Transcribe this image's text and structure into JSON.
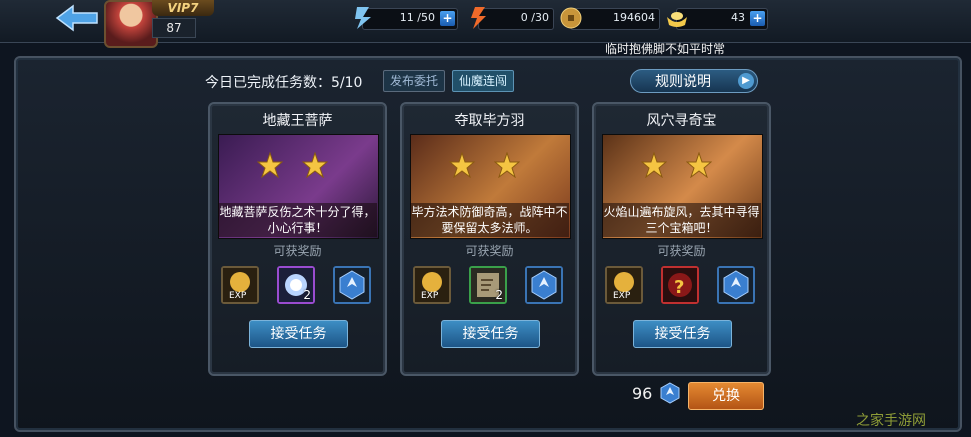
{
  "topbar": {
    "vip_label": "VIP7",
    "level": "87",
    "stamina": "11 /50",
    "energy": "0 /30",
    "gold": "194604",
    "ingots": "43",
    "plus_symbol": "+",
    "notice": "临时抱佛脚不如平时常"
  },
  "header": {
    "tasks_status": "今日已完成任务数：5/10",
    "publish_label": "发布委托",
    "xianmo_label": "仙魔连闯",
    "rules_label": "规则说明"
  },
  "cards": [
    {
      "title": "地藏王菩萨",
      "description": "地藏菩萨反伤之术十分了得，小心行事！",
      "reward_title": "可获奖励",
      "reward2_count": "2",
      "accept_label": "接受任务",
      "art_colors": [
        "#3a1c52",
        "#7a3b8c"
      ]
    },
    {
      "title": "夺取毕方羽",
      "description": "毕方法术防御奇高，战阵中不要保留太多法师。",
      "reward_title": "可获奖励",
      "reward2_count": "2",
      "accept_label": "接受任务",
      "art_colors": [
        "#5a2c1a",
        "#c07a3a"
      ]
    },
    {
      "title": "风穴寻奇宝",
      "description": "火焰山遍布旋风，去其中寻得三个宝箱吧！",
      "reward_title": "可获奖励",
      "reward2_count": "",
      "accept_label": "接受任务",
      "art_colors": [
        "#5b3218",
        "#d48a4a"
      ]
    }
  ],
  "footer": {
    "coins": "96",
    "exchange_label": "兑换"
  },
  "watermark": "之家手游网",
  "colors": {
    "accent_blue": "#2c6fa8",
    "accent_orange": "#d77a2a",
    "star_gold": "#f5c542"
  }
}
